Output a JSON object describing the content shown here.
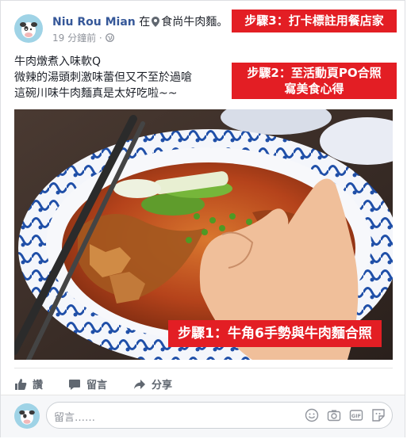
{
  "post": {
    "author": "Niu Rou Mian",
    "location_prefix": "在",
    "location": "食尚牛肉麵",
    "location_suffix": "。",
    "timestamp": "19 分鐘前",
    "dot": "·",
    "privacy_icon": "globe-icon",
    "text_lines": [
      "牛肉燉煮入味軟Q",
      "微辣的湯頭刺激味蕾但又不至於過嗆",
      "這碗川味牛肉麵真是太好吃啦~~"
    ]
  },
  "badges": {
    "step3": "步驟3：打卡標註用餐店家",
    "step2": "步驟2：至活動頁PO合照\n寫美食心得",
    "step1": "步驟1：牛角6手勢與牛肉麵合照"
  },
  "actions": {
    "like": "讚",
    "comment": "留言",
    "share": "分享"
  },
  "comment_box": {
    "placeholder": "留言……",
    "icons": [
      "emoji-icon",
      "camera-icon",
      "gif-icon",
      "sticker-icon"
    ]
  },
  "colors": {
    "badge_red": "#e31e24",
    "link_blue": "#365899",
    "muted": "#90949c"
  }
}
